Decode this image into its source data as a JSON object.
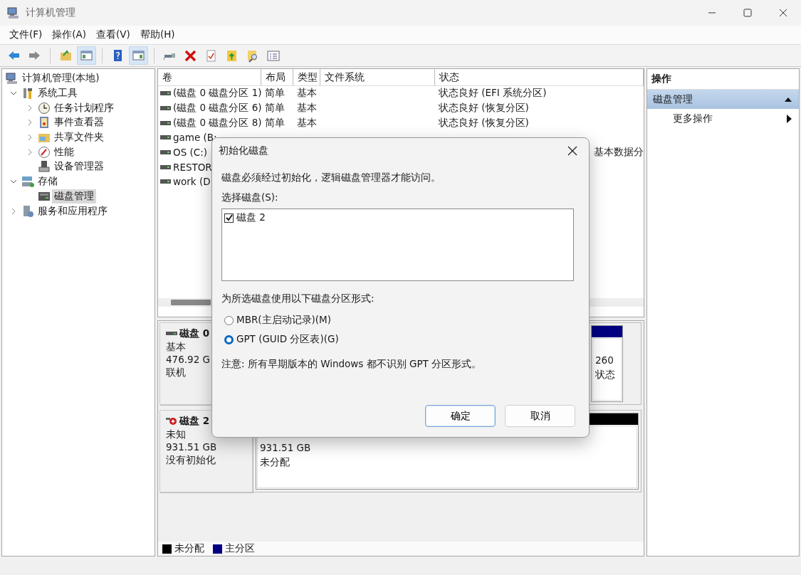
{
  "window": {
    "title": "计算机管理"
  },
  "menu": [
    "文件(F)",
    "操作(A)",
    "查看(V)",
    "帮助(H)"
  ],
  "toolbar": [
    {
      "kind": "back",
      "pressed": false
    },
    {
      "kind": "forward",
      "pressed": false
    },
    {
      "kind": "up",
      "pressed": false
    },
    {
      "kind": "tree",
      "pressed": true
    },
    {
      "kind": "help",
      "pressed": false
    },
    {
      "kind": "pane",
      "pressed": true
    },
    {
      "kind": "connect",
      "pressed": false
    },
    {
      "kind": "delete",
      "pressed": false
    },
    {
      "kind": "properties",
      "pressed": false
    },
    {
      "kind": "export",
      "pressed": false
    },
    {
      "kind": "find",
      "pressed": false
    },
    {
      "kind": "list",
      "pressed": false
    }
  ],
  "tree": [
    {
      "label": "计算机管理(本地)",
      "kind": "computer",
      "selected": false,
      "children": [
        {
          "label": "系统工具",
          "kind": "tools",
          "expanded": true,
          "selected": false,
          "children": [
            {
              "label": "任务计划程序",
              "kind": "clock",
              "expanded": false,
              "selected": false
            },
            {
              "label": "事件查看器",
              "kind": "event",
              "expanded": false,
              "selected": false
            },
            {
              "label": "共享文件夹",
              "kind": "share",
              "expanded": false,
              "selected": false
            },
            {
              "label": "性能",
              "kind": "perf",
              "expanded": false,
              "selected": false
            },
            {
              "label": "设备管理器",
              "kind": "device",
              "selected": false
            }
          ]
        },
        {
          "label": "存储",
          "kind": "storage",
          "expanded": true,
          "selected": false,
          "children": [
            {
              "label": "磁盘管理",
              "kind": "disk",
              "selected": true
            }
          ]
        },
        {
          "label": "服务和应用程序",
          "kind": "services",
          "expanded": false,
          "selected": false
        }
      ]
    }
  ],
  "volumes": {
    "columns": [
      "卷",
      "布局",
      "类型",
      "文件系统",
      "状态"
    ],
    "rows": [
      {
        "volume": "(磁盘 0 磁盘分区 1)",
        "layout": "简单",
        "type": "基本",
        "status": "状态良好 (EFI 系统分区)"
      },
      {
        "volume": "(磁盘 0 磁盘分区 6)",
        "layout": "简单",
        "type": "基本",
        "status": "状态良好 (恢复分区)"
      },
      {
        "volume": "(磁盘 0 磁盘分区 8)",
        "layout": "简单",
        "type": "基本",
        "status": "状态良好 (恢复分区)"
      },
      {
        "volume": "game (B:"
      },
      {
        "volume": "OS (C:)",
        "status": "基本数据分"
      },
      {
        "volume": "RESTOR"
      },
      {
        "volume": "work (D"
      }
    ]
  },
  "disks": [
    {
      "name": "磁盘 0",
      "kind": "online",
      "lines": [
        "基本",
        "476.92 G",
        "联机"
      ],
      "partitions": [
        {
          "color": "#000080",
          "lines": [
            "260",
            "状态"
          ]
        }
      ]
    },
    {
      "name": "磁盘 2",
      "kind": "error",
      "lines": [
        "未知",
        "931.51 GB",
        "没有初始化"
      ],
      "partitions": [
        {
          "color": "#000000",
          "lines": [
            "931.51 GB",
            "未分配"
          ]
        }
      ]
    }
  ],
  "legend": [
    {
      "color": "#000000",
      "label": "未分配"
    },
    {
      "color": "#000080",
      "label": "主分区"
    }
  ],
  "actions": {
    "title": "操作",
    "items": [
      {
        "label": "磁盘管理",
        "kind": "header",
        "expanded": true
      },
      {
        "label": "更多操作",
        "kind": "submenu"
      }
    ]
  },
  "dialog": {
    "title": "初始化磁盘",
    "message": "磁盘必须经过初始化，逻辑磁盘管理器才能访问。",
    "select_label": "选择磁盘(S):",
    "disks": [
      {
        "label": "磁盘 2",
        "checked": true
      }
    ],
    "style_label": "为所选磁盘使用以下磁盘分区形式:",
    "options": [
      {
        "label": "MBR(主启动记录)(M)",
        "selected": false
      },
      {
        "label": "GPT (GUID 分区表)(G)",
        "selected": true
      }
    ],
    "note": "注意: 所有早期版本的 Windows 都不识别 GPT 分区形式。",
    "buttons": [
      {
        "label": "确定",
        "default": true
      },
      {
        "label": "取消",
        "default": false
      }
    ]
  }
}
